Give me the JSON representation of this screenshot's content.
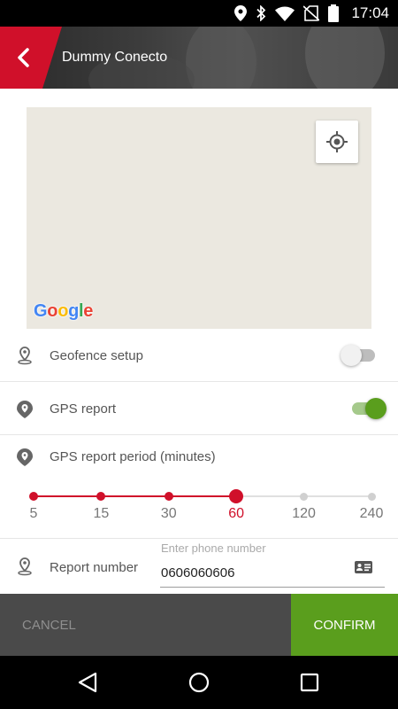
{
  "status_bar": {
    "time": "17:04",
    "icons": [
      "location-icon",
      "bluetooth-icon",
      "wifi-icon",
      "no-sim-icon",
      "battery-icon"
    ]
  },
  "header": {
    "title": "Dummy Conecto",
    "back_icon": "chevron-left-icon",
    "accent_color": "#d0102a"
  },
  "map": {
    "logo_text": "Google",
    "locate_icon": "my-location-icon",
    "background_color": "#ebe8e0"
  },
  "settings": {
    "geofence": {
      "label": "Geofence setup",
      "enabled": false,
      "icon": "map-pin-icon"
    },
    "gps_report": {
      "label": "GPS report",
      "enabled": true,
      "icon": "location-bubble-icon"
    },
    "gps_period": {
      "label": "GPS report period (minutes)",
      "icon": "location-bubble-icon",
      "options": [
        "5",
        "15",
        "30",
        "60",
        "120",
        "240"
      ],
      "selected": "60"
    },
    "report_number": {
      "label": "Report number",
      "placeholder": "Enter phone number",
      "value": "0606060606",
      "icon": "map-pin-icon",
      "contact_icon": "contact-card-icon"
    }
  },
  "actions": {
    "cancel_label": "CANCEL",
    "confirm_label": "CONFIRM",
    "confirm_color": "#5a9e1d"
  },
  "nav": {
    "back_icon": "triangle-back-icon",
    "home_icon": "circle-home-icon",
    "recents_icon": "square-recents-icon"
  }
}
